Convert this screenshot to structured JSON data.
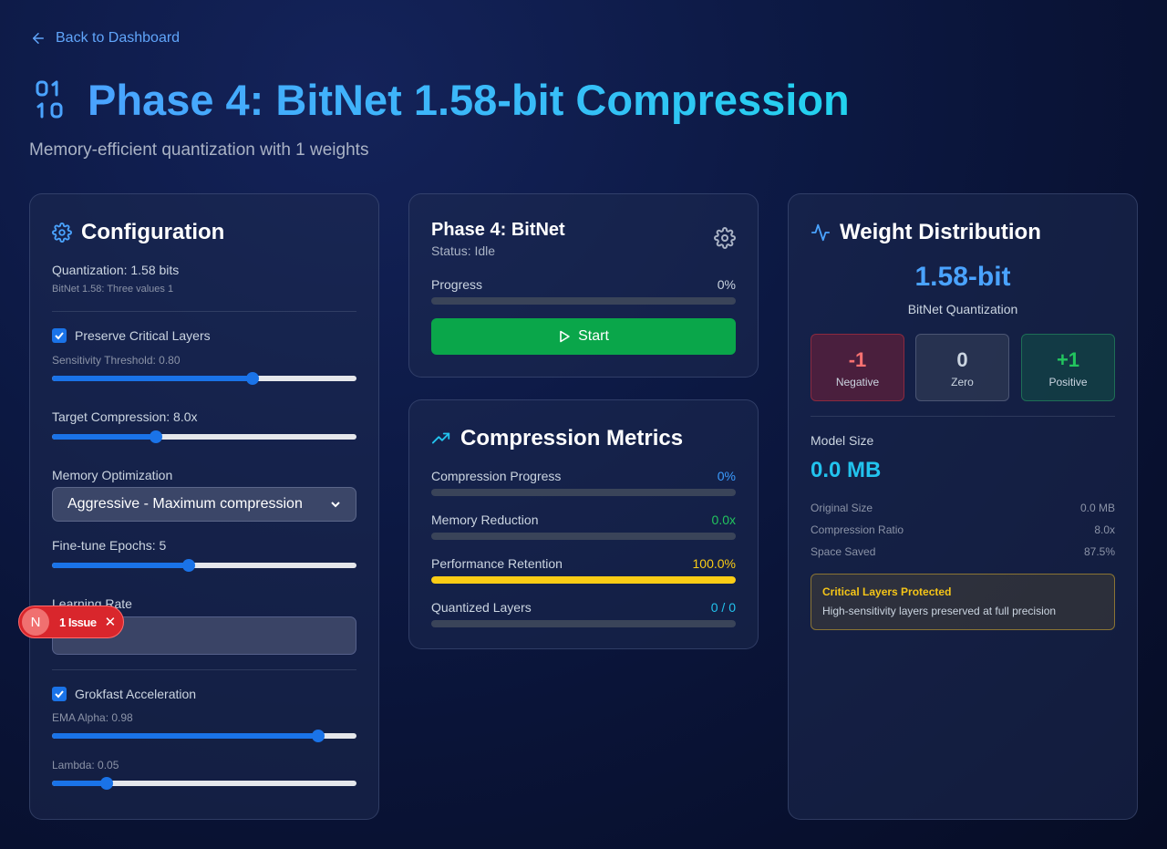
{
  "nav": {
    "back_label": "Back to Dashboard"
  },
  "header": {
    "title": "Phase 4: BitNet 1.58-bit Compression",
    "subtitle": "Memory-efficient quantization with 1 weights",
    "icon": "binary-icon"
  },
  "config": {
    "title": "Configuration",
    "quantization": "Quantization: 1.58 bits",
    "quantization_sub": "BitNet 1.58: Three values 1",
    "preserve_label": "Preserve Critical Layers",
    "preserve_checked": true,
    "sensitivity_label": "Sensitivity Threshold: 0.80",
    "sensitivity_value": 0.8,
    "sensitivity_fraction": 0.66,
    "target_label": "Target Compression: 8.0x",
    "target_value": 8.0,
    "target_fraction": 0.34,
    "memory_label": "Memory Optimization",
    "memory_selected": "Aggressive - Maximum compression",
    "epochs_label": "Fine-tune Epochs: 5",
    "epochs_value": 5,
    "epochs_fraction": 0.45,
    "lr_label": "Learning Rate",
    "grokfast_label": "Grokfast Acceleration",
    "grokfast_checked": true,
    "ema_label": "EMA Alpha: 0.98",
    "ema_value": 0.98,
    "ema_fraction": 0.875,
    "lambda_label": "Lambda: 0.05",
    "lambda_value": 0.05,
    "lambda_fraction": 0.18
  },
  "issue_badge": {
    "letter": "N",
    "label": "1 Issue"
  },
  "phase": {
    "title": "Phase 4: BitNet",
    "status": "Status: Idle",
    "progress_label": "Progress",
    "progress_value": "0%",
    "progress_fraction": 0,
    "start_label": "Start"
  },
  "metrics": {
    "title": "Compression Metrics",
    "items": [
      {
        "label": "Compression Progress",
        "value": "0%",
        "color": "#3b9cff",
        "fraction": 0,
        "bar_color": "#3b9cff"
      },
      {
        "label": "Memory Reduction",
        "value": "0.0x",
        "color": "#22c55e",
        "fraction": 0,
        "bar_color": "#22c55e"
      },
      {
        "label": "Performance Retention",
        "value": "100.0%",
        "color": "#facc15",
        "fraction": 1.0,
        "bar_color": "#facc15"
      },
      {
        "label": "Quantized Layers",
        "value": "0 / 0",
        "color": "#22c3ee",
        "fraction": 0,
        "bar_color": "#22c3ee"
      }
    ]
  },
  "weight": {
    "title": "Weight Distribution",
    "bits": "1.58-bit",
    "bits_sub": "BitNet Quantization",
    "values": [
      {
        "value": "-1",
        "label": "Negative",
        "color": "#f87171"
      },
      {
        "value": "0",
        "label": "Zero",
        "color": "#cbd5e1"
      },
      {
        "value": "+1",
        "label": "Positive",
        "color": "#22c55e"
      }
    ],
    "model_size_label": "Model Size",
    "model_size_value": "0.0 MB",
    "stats": [
      {
        "label": "Original Size",
        "value": "0.0 MB"
      },
      {
        "label": "Compression Ratio",
        "value": "8.0x"
      },
      {
        "label": "Space Saved",
        "value": "87.5%"
      }
    ],
    "critical_title": "Critical Layers Protected",
    "critical_desc": "High-sensitivity layers preserved at full precision"
  }
}
